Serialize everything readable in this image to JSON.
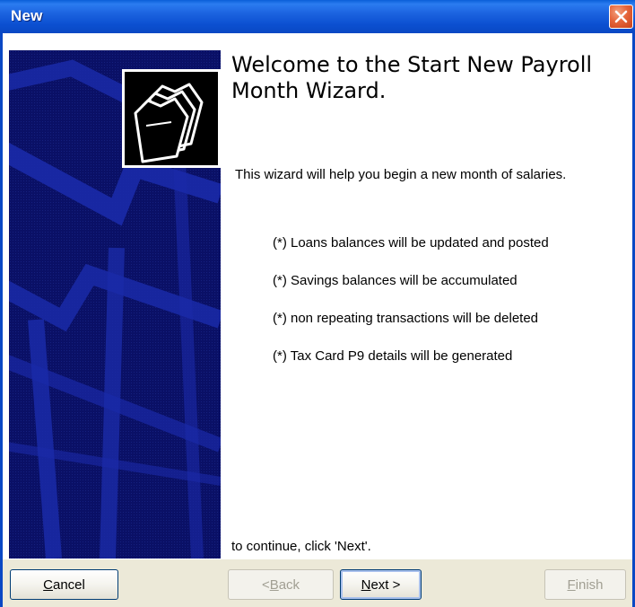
{
  "window": {
    "title": "New"
  },
  "wizard": {
    "heading": "Welcome to the Start New Payroll Month Wizard.",
    "intro": "This wizard will help you begin a new month of salaries.",
    "bullets": [
      "(*) Loans balances will be updated and posted",
      "(*) Savings balances will be accumulated",
      "(*) non repeating transactions will be deleted",
      "(*) Tax Card P9 details will be generated"
    ],
    "continue_text": "to continue, click 'Next'."
  },
  "buttons": {
    "cancel": {
      "first": "C",
      "rest": "ancel"
    },
    "back": {
      "prefix": "< ",
      "first": "B",
      "rest": "ack"
    },
    "next": {
      "first": "N",
      "rest": "ext >"
    },
    "finish": {
      "first": "F",
      "rest": "inish"
    }
  },
  "icons": {
    "close": "close-icon",
    "banner": "wizard-folder-graphic",
    "folder": "folder-stack-icon"
  },
  "colors": {
    "titlebar": "#0a48c4",
    "banner": "#0a1066",
    "close": "#e5643a",
    "button_face": "#ece9d8"
  }
}
